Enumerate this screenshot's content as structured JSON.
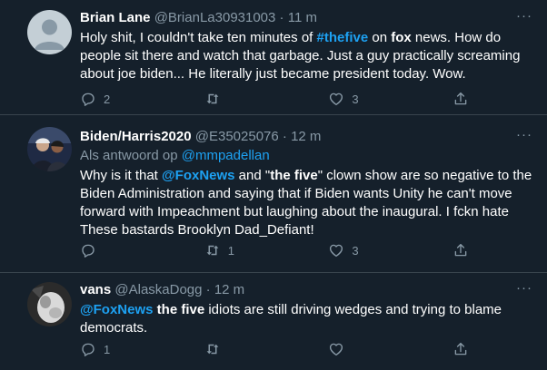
{
  "tweets": [
    {
      "name": "Brian Lane",
      "handle": "@BrianLa30931003",
      "dot": "·",
      "time": "11 m",
      "more": "···",
      "body_parts": [
        {
          "text": "Holy shit, I couldn't take ten minutes of ",
          "style": "plain"
        },
        {
          "text": "#thefive",
          "style": "hashtag"
        },
        {
          "text": " on ",
          "style": "plain"
        },
        {
          "text": "fox",
          "style": "bold"
        },
        {
          "text": " news. How do people sit there and watch that garbage. Just a guy practically screaming about joe biden... He literally just became president today. Wow.",
          "style": "plain"
        }
      ],
      "replies": "2",
      "retweets": "",
      "likes": "3"
    },
    {
      "name": "Biden/Harris2020",
      "handle": "@E35025076",
      "dot": "·",
      "time": "12 m",
      "more": "···",
      "reply_prefix": "Als antwoord op ",
      "reply_to": "@mmpadellan",
      "body_parts": [
        {
          "text": "Why is it that ",
          "style": "plain"
        },
        {
          "text": "@FoxNews",
          "style": "mention"
        },
        {
          "text": " and \"",
          "style": "plain"
        },
        {
          "text": "the five",
          "style": "bold"
        },
        {
          "text": "\" clown show are so negative to the Biden Administration and saying that if Biden wants Unity he can't move forward with Impeachment but laughing about the inaugural. I fckn hate These bastards Brooklyn Dad_Defiant!",
          "style": "plain"
        }
      ],
      "replies": "",
      "retweets": "1",
      "likes": "3"
    },
    {
      "name": "vans",
      "handle": "@AlaskaDogg",
      "dot": "·",
      "time": "12 m",
      "more": "···",
      "body_parts": [
        {
          "text": "@FoxNews",
          "style": "mention"
        },
        {
          "text": " ",
          "style": "plain"
        },
        {
          "text": "the five",
          "style": "bold"
        },
        {
          "text": " idiots are still driving wedges and trying to blame democrats.",
          "style": "plain"
        }
      ],
      "replies": "1",
      "retweets": "",
      "likes": ""
    }
  ],
  "icons": {
    "reply": "reply-icon",
    "retweet": "retweet-icon",
    "like": "heart-icon",
    "share": "share-icon"
  },
  "colors": {
    "background": "#15202b",
    "border": "#38444d",
    "secondary_text": "#8899a6",
    "accent": "#1da1f2"
  }
}
